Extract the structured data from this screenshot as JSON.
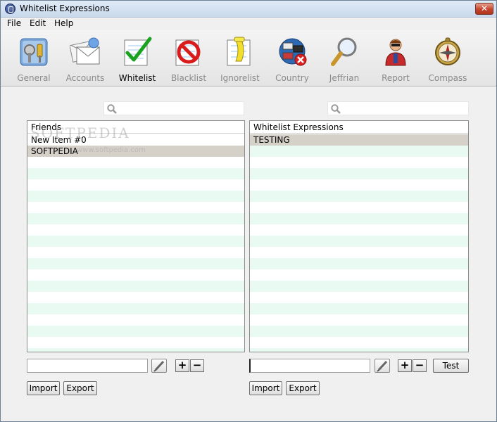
{
  "window": {
    "title": "Whitelist Expressions",
    "close_glyph": "✕"
  },
  "menu": [
    "File",
    "Edit",
    "Help"
  ],
  "toolbar": {
    "items": [
      {
        "label": "General",
        "icon": "general-settings-icon"
      },
      {
        "label": "Accounts",
        "icon": "accounts-mail-icon"
      },
      {
        "label": "Whitelist",
        "icon": "whitelist-checkmark-icon",
        "active": true
      },
      {
        "label": "Blacklist",
        "icon": "blacklist-prohibited-icon"
      },
      {
        "label": "Ignorelist",
        "icon": "ignorelist-icon"
      },
      {
        "label": "Country",
        "icon": "country-flags-icon"
      },
      {
        "label": "Jeffrian",
        "icon": "magnifier-icon"
      },
      {
        "label": "Report",
        "icon": "report-person-icon"
      },
      {
        "label": "Compass",
        "icon": "compass-icon"
      }
    ]
  },
  "left_panel": {
    "header": "Friends",
    "rows": [
      "New Item #0",
      "SOFTPEDIA"
    ],
    "selected_index": 1,
    "import_label": "Import",
    "export_label": "Export",
    "plus": "+",
    "minus": "−"
  },
  "right_panel": {
    "header": "Whitelist Expressions",
    "rows": [
      "TESTING"
    ],
    "selected_index": 0,
    "import_label": "Import",
    "export_label": "Export",
    "test_label": "Test",
    "plus": "+",
    "minus": "−"
  },
  "watermark": {
    "main": "SOFTPEDIA",
    "sub": "www.softpedia.com"
  },
  "colors": {
    "row_alt": "#e9faf2",
    "selected_row": "#d5d1c8",
    "toolbar_label_inactive": "#8a8a8a"
  }
}
